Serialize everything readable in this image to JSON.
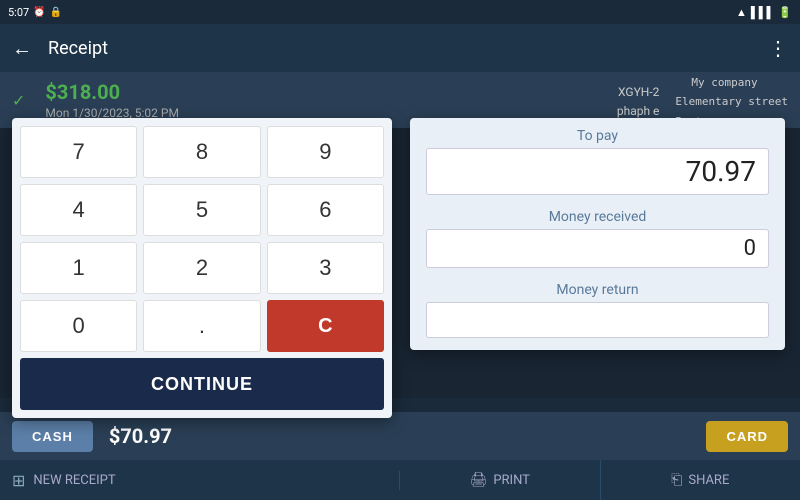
{
  "statusBar": {
    "time": "5:07",
    "icons": [
      "battery",
      "wifi",
      "signal"
    ]
  },
  "header": {
    "title": "Receipt",
    "backIcon": "←",
    "menuIcon": "⋮"
  },
  "receiptStrip": {
    "checkmark": "✓",
    "amount": "$318.00",
    "date": "Mon 1/30/2023, 5:02 PM",
    "code": "XGYH-2\nphaph e",
    "company": "My company\nElementary street\nBoston"
  },
  "numpad": {
    "buttons": [
      "7",
      "8",
      "9",
      "4",
      "5",
      "6",
      "1",
      "2",
      "3",
      "0",
      ".",
      "C"
    ],
    "continueLabel": "CONTINUE"
  },
  "paymentPanel": {
    "toPayLabel": "To pay",
    "toPayValue": "70.97",
    "moneyReceivedLabel": "Money received",
    "moneyReceivedValue": "0",
    "moneyReturnLabel": "Money return",
    "moneyReturnValue": ""
  },
  "actionBar": {
    "cashLabel": "CASH",
    "amountDisplay": "$70.97",
    "cardLabel": "CARD"
  },
  "bottomBar": {
    "calculatorIcon": "⊞",
    "newReceiptLabel": "NEW RECEIPT",
    "printIcon": "🖨",
    "printLabel": "PRINT",
    "shareIcon": "⎗",
    "shareLabel": "SHARE"
  }
}
